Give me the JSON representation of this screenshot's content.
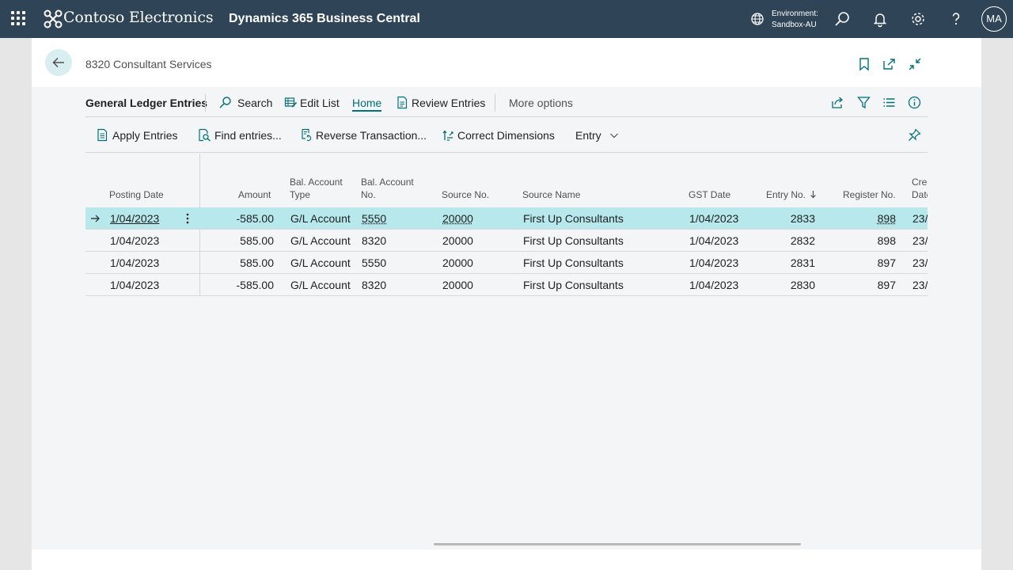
{
  "topbar": {
    "brand": "Contoso Electronics",
    "product": "Dynamics 365 Business Central",
    "environment_label": "Environment:",
    "environment_name": "Sandbox-AU",
    "user_initials": "MA",
    "icons": [
      "waffle-icon",
      "contoso-logo-icon",
      "environment-icon",
      "search-icon",
      "bell-icon",
      "gear-icon",
      "help-icon"
    ]
  },
  "header": {
    "breadcrumb": "8320 Consultant Services"
  },
  "actionbar": {
    "title": "General Ledger Entries",
    "search": "Search",
    "edit_list": "Edit List",
    "home": "Home",
    "review_entries": "Review Entries",
    "more_options": "More options"
  },
  "subbar": {
    "apply_entries": "Apply Entries",
    "find_entries": "Find entries...",
    "reverse_transaction": "Reverse Transaction...",
    "correct_dimensions": "Correct Dimensions",
    "entry": "Entry"
  },
  "grid": {
    "headers": {
      "posting_date": "Posting Date",
      "amount": "Amount",
      "bal_account_type_1": "Bal. Account",
      "bal_account_type_2": "Type",
      "bal_account_no_1": "Bal. Account",
      "bal_account_no_2": "No.",
      "source_no": "Source No.",
      "source_name": "Source Name",
      "gst_date": "GST Date",
      "entry_no": "Entry No.",
      "register_no": "Register No.",
      "created_1": "Crea",
      "created_2": "Date"
    },
    "rows": [
      {
        "posting_date": "1/04/2023",
        "amount": "-585.00",
        "bal_type": "G/L Account",
        "bal_no": "5550",
        "source_no": "20000",
        "source_name": "First Up Consultants",
        "gst_date": "1/04/2023",
        "entry_no": "2833",
        "register_no": "898",
        "created": "23/"
      },
      {
        "posting_date": "1/04/2023",
        "amount": "585.00",
        "bal_type": "G/L Account",
        "bal_no": "8320",
        "source_no": "20000",
        "source_name": "First Up Consultants",
        "gst_date": "1/04/2023",
        "entry_no": "2832",
        "register_no": "898",
        "created": "23/"
      },
      {
        "posting_date": "1/04/2023",
        "amount": "585.00",
        "bal_type": "G/L Account",
        "bal_no": "5550",
        "source_no": "20000",
        "source_name": "First Up Consultants",
        "gst_date": "1/04/2023",
        "entry_no": "2831",
        "register_no": "897",
        "created": "23/"
      },
      {
        "posting_date": "1/04/2023",
        "amount": "-585.00",
        "bal_type": "G/L Account",
        "bal_no": "8320",
        "source_no": "20000",
        "source_name": "First Up Consultants",
        "gst_date": "1/04/2023",
        "entry_no": "2830",
        "register_no": "897",
        "created": "23/"
      }
    ]
  },
  "colors": {
    "topbar": "#2f4457",
    "accent": "#00707a",
    "selected_row": "#b6e8ec"
  }
}
